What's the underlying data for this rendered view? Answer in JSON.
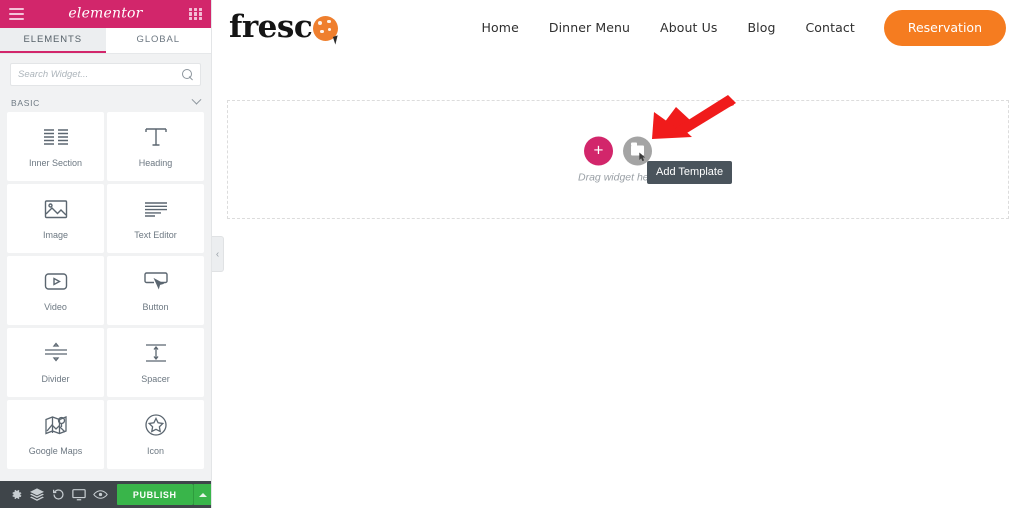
{
  "panel": {
    "brand": "elementor",
    "menu_icon": "hamburger-icon",
    "apps_icon": "grid-apps-icon",
    "tabs": [
      {
        "label": "ELEMENTS",
        "active": true
      },
      {
        "label": "GLOBAL",
        "active": false
      }
    ],
    "search": {
      "placeholder": "Search Widget...",
      "value": "",
      "icon": "search-icon"
    },
    "section": {
      "label": "BASIC",
      "collapse_icon": "chevron-down-icon"
    },
    "widgets": [
      {
        "label": "Inner Section",
        "icon": "columns-icon"
      },
      {
        "label": "Heading",
        "icon": "text-t-icon"
      },
      {
        "label": "Image",
        "icon": "image-icon"
      },
      {
        "label": "Text Editor",
        "icon": "paragraph-lines-icon"
      },
      {
        "label": "Video",
        "icon": "video-play-icon"
      },
      {
        "label": "Button",
        "icon": "button-cursor-icon"
      },
      {
        "label": "Divider",
        "icon": "divider-icon"
      },
      {
        "label": "Spacer",
        "icon": "spacer-icon"
      },
      {
        "label": "Google Maps",
        "icon": "map-pin-icon"
      },
      {
        "label": "Icon",
        "icon": "star-circle-icon"
      }
    ],
    "footer": {
      "icons": [
        "settings-gear-icon",
        "layers-navigator-icon",
        "history-revisions-icon",
        "responsive-mode-icon",
        "preview-eye-icon"
      ],
      "publish_label": "PUBLISH",
      "publish_options_icon": "caret-up-icon",
      "publish_color": "#39b54a"
    },
    "collapse_handle": "‹",
    "accent_color": "#d2266b"
  },
  "site": {
    "logo": {
      "text": "fresc",
      "mark": "pizza-o-icon"
    },
    "nav": [
      {
        "label": "Home"
      },
      {
        "label": "Dinner Menu"
      },
      {
        "label": "About Us"
      },
      {
        "label": "Blog"
      },
      {
        "label": "Contact"
      }
    ],
    "cta": {
      "label": "Reservation",
      "color": "#f57c20"
    }
  },
  "dropzone": {
    "add_section_icon": "plus-icon",
    "add_template_icon": "folder-icon",
    "hint_text": "Drag widget here",
    "tooltip": "Add Template"
  },
  "annotation": {
    "arrow_color": "#f01b1b",
    "points_to": "add-template-button"
  }
}
